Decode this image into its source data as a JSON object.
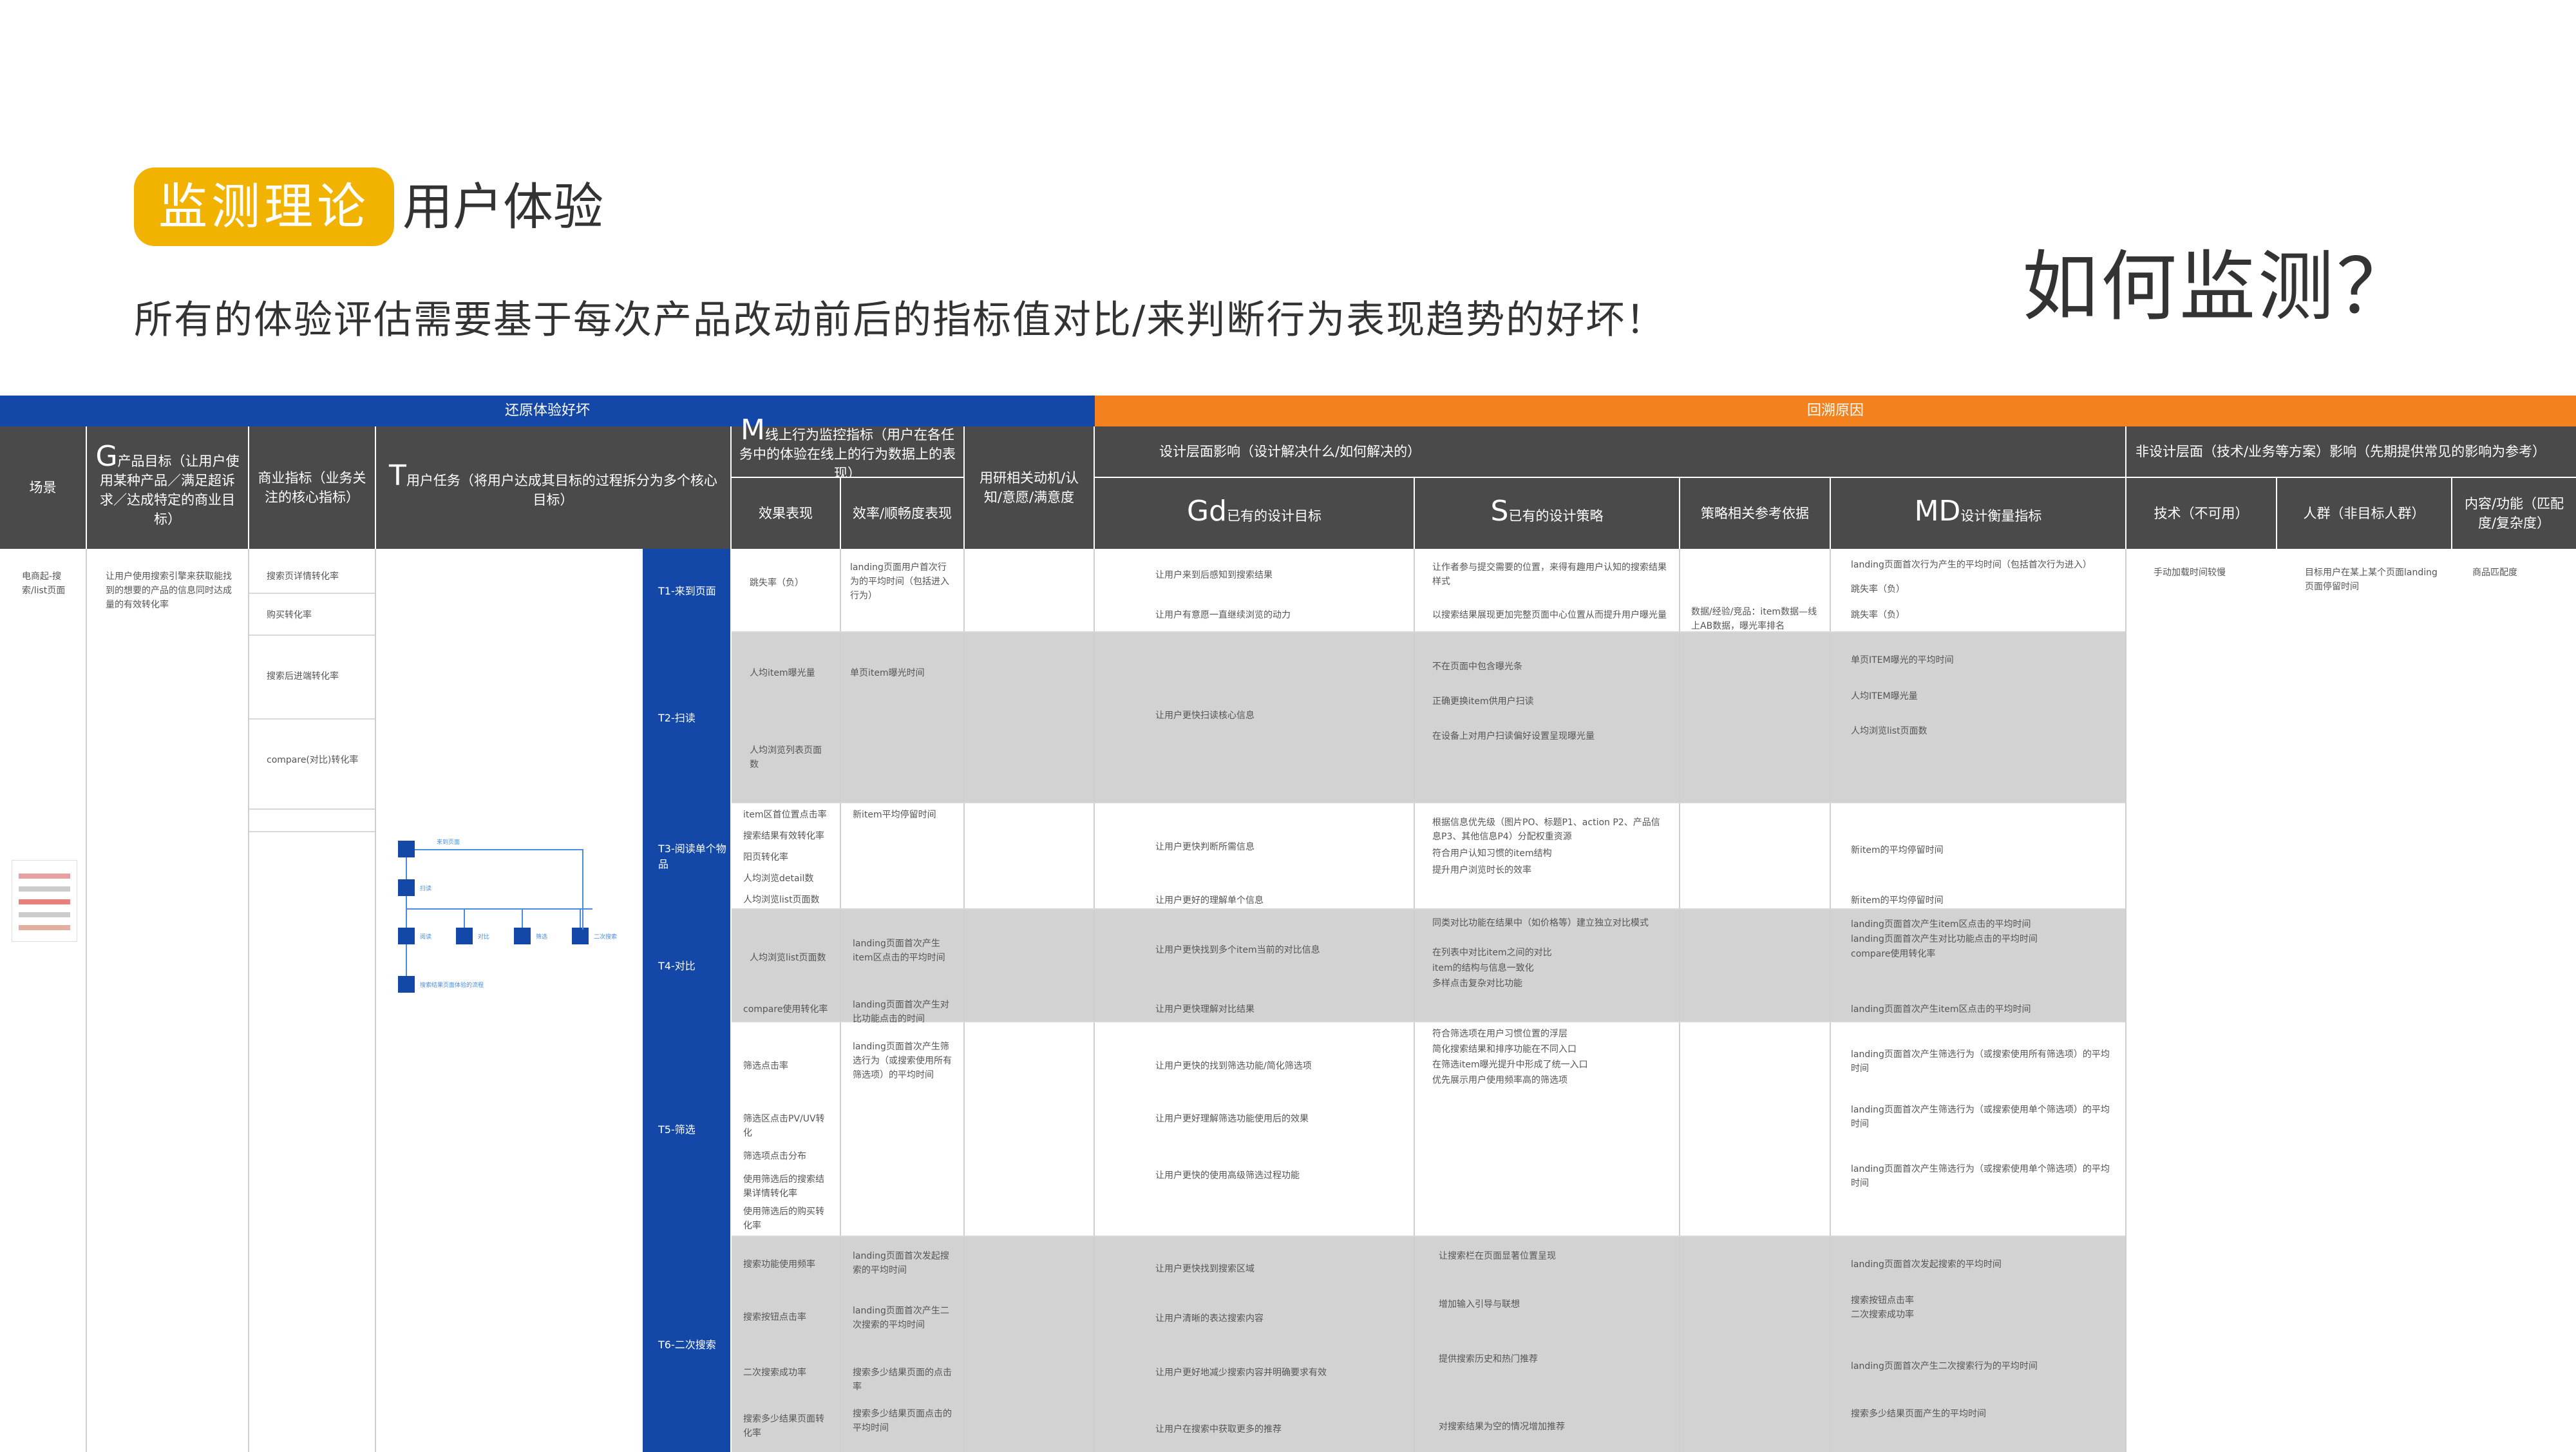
{
  "header": {
    "tag": "监测理论",
    "title": "用户体验",
    "subtitle": "所有的体验评估需要基于每次产品改动前后的指标值对比/来判断行为表现趋势的好坏！",
    "question": "如何监测？"
  },
  "bars": {
    "left": "还原体验好坏",
    "right": "回溯原因"
  },
  "columns": {
    "scene": "场景",
    "g_letter": "G",
    "g_text": "产品目标（让用户使用某种产品／满足超诉求／达成特定的商业目标）",
    "biz": "商业指标（业务关注的核心指标）",
    "t_letter": "T",
    "t_text": "用户任务（将用户达成其目标的过程拆分为多个核心目标）",
    "m_letter": "M",
    "m_text": "线上行为监控指标（用户在各任务中的体验在线上的行为数据上的表现）",
    "effect": "效果表现",
    "efficiency": "效率/顺畅度表现",
    "research": "用研相关动机/认知/意愿/满意度",
    "design_impact": "设计层面影响（设计解决什么/如何解决的）",
    "gd_letter": "Gd",
    "gd_text": "已有的设计目标",
    "s_letter": "S",
    "s_text": "已有的设计策略",
    "strategy_ref": "策略相关参考依据",
    "md_letter": "MD",
    "md_text": "设计衡量指标",
    "non_design": "非设计层面（技术/业务等方案）影响（先期提供常见的影响为参考）",
    "tech": "技术（不可用）",
    "crowd": "人群（非目标人群）",
    "content": "内容/功能（匹配度/复杂度）"
  },
  "scene_text": "电商起-搜索/list页面",
  "goal_text": "让用户使用搜索引擎来获取能找到的想要的产品的信息同时达成量的有效转化率",
  "biz_items": [
    "搜索页详情转化率",
    "购买转化率",
    "搜索后进端转化率",
    "compare(对比)转化率"
  ],
  "tasks": [
    {
      "id": "T1-来到页面",
      "effect": [
        "跳失率（负）"
      ],
      "efficiency": [
        "landing页面用户首次行为的平均时间（包括进入行为）"
      ],
      "gd": [
        "让用户来到后感知到搜索结果",
        "让用户有意愿一直继续浏览的动力"
      ],
      "s": [
        "让作者参与提交需要的位置，来得有趣用户认知的搜索结果样式",
        "以搜索结果展现更加完整页面中心位置从而提升用户曝光量"
      ],
      "ref": "数据/经验/竞品：item数据—线上AB数据，曝光率排名",
      "md": [
        "landing页面首次行为产生的平均时间（包括首次行为进入）",
        "跳失率（负）",
        "跳失率（负）"
      ]
    },
    {
      "id": "T2-扫读",
      "effect": [
        "人均item曝光量",
        "人均浏览列表页面数"
      ],
      "efficiency": [
        "单页item曝光时间"
      ],
      "gd": [
        "让用户更快扫读核心信息"
      ],
      "s": [
        "不在页面中包含曝光条",
        "正确更换item供用户扫读",
        "在设备上对用户扫读偏好设置呈现曝光量"
      ],
      "md": [
        "单页ITEM曝光的平均时间",
        "人均ITEM曝光量",
        "人均浏览list页面数"
      ]
    },
    {
      "id": "T3-阅读单个物品",
      "effect": [
        "item区首位置点击率",
        "搜索结果有效转化率",
        "阳页转化率",
        "人均浏览detail数",
        "人均浏览list页面数"
      ],
      "efficiency": [
        "新item平均停留时间"
      ],
      "gd": [
        "让用户更快判断所需信息",
        "让用户更好的理解单个信息"
      ],
      "s": [
        "根据信息优先级（图片PO、标题P1、action P2、产品信息P3、其他信息P4）分配权重资源",
        "符合用户认知习惯的item结构",
        "提升用户浏览时长的效率"
      ],
      "md": [
        "新item的平均停留时间",
        "新item的平均停留时间"
      ]
    },
    {
      "id": "T4-对比",
      "effect": [
        "人均浏览list页面数",
        "compare使用转化率"
      ],
      "efficiency": [
        "landing页面首次产生item区点击的平均时间",
        "landing页面首次产生对比功能点击的时间"
      ],
      "gd": [
        "让用户更快找到多个item当前的对比信息",
        "让用户更快理解对比结果"
      ],
      "s": [
        "同类对比功能在结果中（如价格等）建立独立对比模式",
        "在列表中对比item之间的对比",
        "item的结构与信息一致化",
        "多样点击复杂对比功能"
      ],
      "md": [
        "landing页面首次产生item区点击的平均时间",
        "landing页面首次产生对比功能点击的平均时间",
        "compare使用转化率",
        "landing页面首次产生item区点击的平均时间"
      ]
    },
    {
      "id": "T5-筛选",
      "effect": [
        "筛选点击率",
        "筛选区点击PV/UV转化",
        "筛选项点击分布",
        "使用筛选后的搜索结果详情转化率",
        "使用筛选后的购买转化率"
      ],
      "efficiency": [
        "landing页面首次产生筛选行为（或搜索使用所有筛选项）的平均时间"
      ],
      "gd": [
        "让用户更快的找到筛选功能/简化筛选项",
        "让用户更好理解筛选功能使用后的效果",
        "让用户更快的使用高级筛选过程功能"
      ],
      "s": [
        "符合筛选项在用户习惯位置的浮层",
        "简化搜索结果和排序功能在不同入口",
        "在筛选item曝光提升中形成了统一入口",
        "优先展示用户使用频率高的筛选项"
      ],
      "md": [
        "landing页面首次产生筛选行为（或搜索使用所有筛选项）的平均时间",
        "landing页面首次产生筛选行为（或搜索使用单个筛选项）的平均时间",
        "landing页面首次产生筛选行为（或搜索使用单个筛选项）的平均时间"
      ]
    },
    {
      "id": "T6-二次搜索",
      "effect": [
        "搜索功能使用频率",
        "搜索按钮点击率",
        "二次搜索成功率",
        "搜索多少结果页面转化率"
      ],
      "efficiency": [
        "landing页面首次发起搜索的平均时间",
        "landing页面首次产生二次搜索的平均时间",
        "搜索多少结果页面的点击率",
        "搜索多少结果页面点击的平均时间"
      ],
      "gd": [
        "让用户更快找到搜索区域",
        "让用户清晰的表达搜索内容",
        "让用户更好地减少搜索内容并明确要求有效",
        "让用户在搜索中获取更多的推荐"
      ],
      "s": [
        "让搜索栏在页面显著位置呈现",
        "增加输入引导与联想",
        "提供搜索历史和热门推荐",
        "对搜索结果为空的情况增加推荐"
      ],
      "md": [
        "landing页面首次发起搜索的平均时间",
        "搜索按钮点击率",
        "二次搜索成功率",
        "landing页面首次产生二次搜索行为的平均时间",
        "搜索多少结果页面产生的平均时间"
      ]
    }
  ],
  "non_design_text": {
    "tech": "手动加载时间较慢",
    "crowd": "目标用户在某上某个页面landing页面停留时间",
    "content": "商品匹配度"
  },
  "flow": {
    "nodes": [
      "T1",
      "T2",
      "T3",
      "T4",
      "T5",
      "T6"
    ],
    "labels": [
      "来到页面",
      "扫读",
      "阅读",
      "对比",
      "筛选",
      "二次搜索",
      "搜索结果页面体验的流程"
    ]
  }
}
